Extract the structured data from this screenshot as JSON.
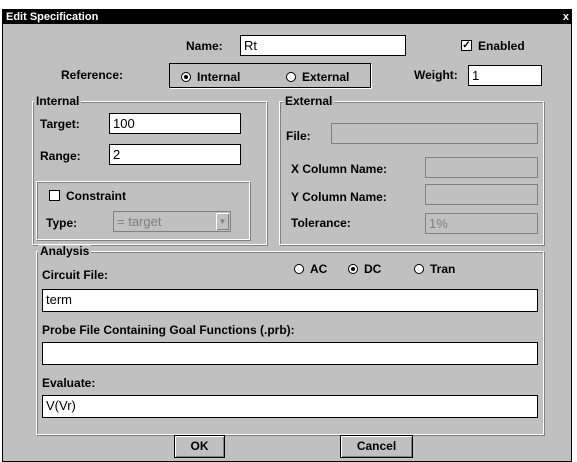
{
  "window": {
    "title": "Edit Specification",
    "close_glyph": "x"
  },
  "name": {
    "label": "Name:",
    "value": "Rt"
  },
  "enabled": {
    "label": "Enabled",
    "checked": true
  },
  "reference": {
    "label": "Reference:",
    "internal": "Internal",
    "external": "External",
    "selected": "Internal"
  },
  "weight": {
    "label": "Weight:",
    "value": "1"
  },
  "internal": {
    "legend": "Internal",
    "target_label": "Target:",
    "target_value": "100",
    "range_label": "Range:",
    "range_value": "2",
    "constraint_label": "Constraint",
    "constraint_checked": false,
    "type_label": "Type:",
    "type_value": "= target"
  },
  "external": {
    "legend": "External",
    "file_label": "File:",
    "file_value": "",
    "xcol_label": "X Column Name:",
    "xcol_value": "",
    "ycol_label": "Y Column Name:",
    "ycol_value": "",
    "tolerance_label": "Tolerance:",
    "tolerance_value": "1%"
  },
  "analysis": {
    "legend": "Analysis",
    "circuit_label": "Circuit File:",
    "circuit_value": "term",
    "modes": [
      "AC",
      "DC",
      "Tran"
    ],
    "selected_mode": "DC",
    "probe_label": "Probe File Containing Goal Functions (.prb):",
    "probe_value": "",
    "evaluate_label": "Evaluate:",
    "evaluate_value": "V(Vr)"
  },
  "buttons": {
    "ok": "OK",
    "cancel": "Cancel"
  }
}
